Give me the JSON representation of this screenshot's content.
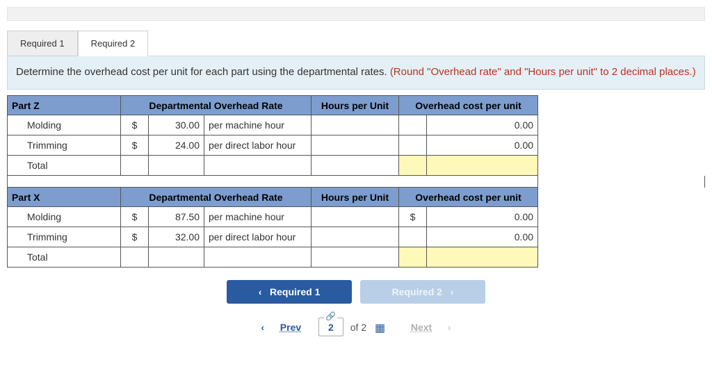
{
  "tabs": {
    "tab1": "Required 1",
    "tab2": "Required 2"
  },
  "instruction": {
    "text": "Determine the overhead cost per unit for each part using the departmental rates. ",
    "note": "(Round \"Overhead rate\" and \"Hours per unit\" to 2 decimal places.)"
  },
  "headers": {
    "rate": "Departmental Overhead Rate",
    "hours": "Hours per Unit",
    "cost": "Overhead cost per unit"
  },
  "nav": {
    "prev_label": "Required 1",
    "next_label": "Required 2"
  },
  "pager": {
    "prev": "Prev",
    "next": "Next",
    "current": "2",
    "of_label": "of",
    "total": "2"
  },
  "part_z": {
    "title": "Part Z",
    "rows": {
      "molding": {
        "label": "Molding",
        "sym": "$",
        "rate": "30.00",
        "unit": "per machine hour",
        "cost": "0.00"
      },
      "trimming": {
        "label": "Trimming",
        "sym": "$",
        "rate": "24.00",
        "unit": "per direct labor hour",
        "cost": "0.00"
      },
      "total": {
        "label": "Total"
      }
    }
  },
  "part_x": {
    "title": "Part X",
    "rows": {
      "molding": {
        "label": "Molding",
        "sym": "$",
        "rate": "87.50",
        "unit": "per machine hour",
        "cost_sym": "$",
        "cost": "0.00"
      },
      "trimming": {
        "label": "Trimming",
        "sym": "$",
        "rate": "32.00",
        "unit": "per direct labor hour",
        "cost": "0.00"
      },
      "total": {
        "label": "Total"
      }
    }
  }
}
